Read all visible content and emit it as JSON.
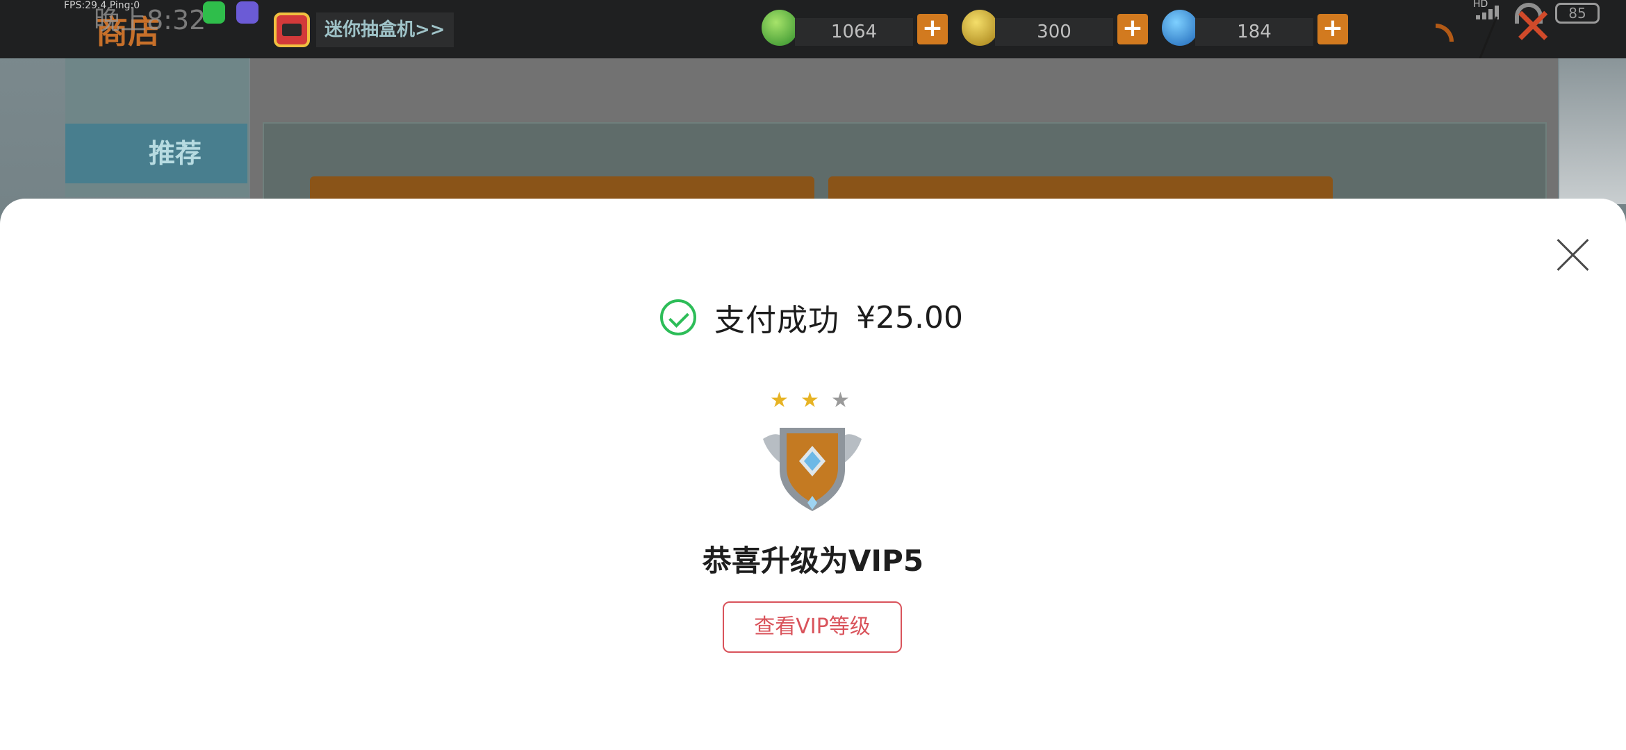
{
  "status_bar": {
    "fps_text": "FPS:29.4  Ping:0",
    "time": "晚上8:32",
    "hd_label": "HD",
    "battery": "85"
  },
  "game": {
    "shop_title": "商店",
    "mini_box_link": "迷你抽盒机>>",
    "currencies": [
      {
        "icon": "green-gem-icon",
        "value": "1064",
        "add": "+"
      },
      {
        "icon": "gold-coin-icon",
        "value": "300",
        "add": "+"
      },
      {
        "icon": "blue-coin-icon",
        "value": "184",
        "add": "+"
      }
    ],
    "nav_recommend": "推荐",
    "close_glyph": "✕"
  },
  "payment_sheet": {
    "success_label": "支付成功",
    "amount": "¥25.00",
    "stars": [
      "★",
      "★",
      "★"
    ],
    "stars_filled": 2,
    "level_message": "恭喜升级为VIP5",
    "view_vip_button": "查看VIP等级",
    "colors": {
      "success_green": "#2dbd58",
      "accent_red": "#d9535b"
    }
  }
}
